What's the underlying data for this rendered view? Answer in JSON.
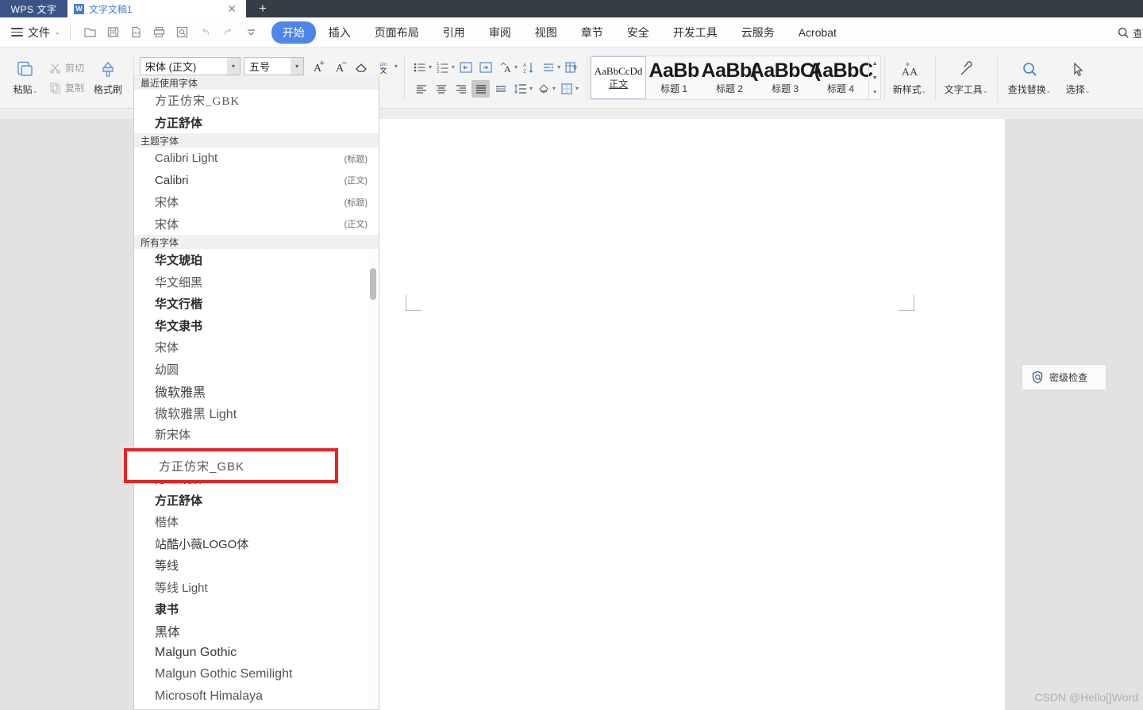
{
  "titlebar": {
    "app_badge": "WPS 文字",
    "doc_tab_icon": "W",
    "doc_tab_title": "文字文稿1",
    "close_glyph": "✕",
    "new_tab_glyph": "+"
  },
  "menubar": {
    "file_label": "文件",
    "file_caret": "⌄",
    "quick_access": [
      {
        "name": "open-icon",
        "enabled": true
      },
      {
        "name": "save-icon",
        "enabled": true
      },
      {
        "name": "export-pdf-icon",
        "enabled": true
      },
      {
        "name": "print-icon",
        "enabled": true
      },
      {
        "name": "print-preview-icon",
        "enabled": true
      },
      {
        "name": "undo-icon",
        "enabled": false
      },
      {
        "name": "redo-icon",
        "enabled": false
      },
      {
        "name": "customize-qat-icon",
        "enabled": true
      }
    ],
    "tabs": [
      {
        "label": "开始",
        "active": true
      },
      {
        "label": "插入",
        "active": false
      },
      {
        "label": "页面布局",
        "active": false
      },
      {
        "label": "引用",
        "active": false
      },
      {
        "label": "审阅",
        "active": false
      },
      {
        "label": "视图",
        "active": false
      },
      {
        "label": "章节",
        "active": false
      },
      {
        "label": "安全",
        "active": false
      },
      {
        "label": "开发工具",
        "active": false
      },
      {
        "label": "云服务",
        "active": false
      },
      {
        "label": "Acrobat",
        "active": false
      }
    ],
    "search_partial_label": "查"
  },
  "ribbon": {
    "clipboard": {
      "paste_label": "粘贴",
      "paste_caret": "⌄",
      "cut_label": "剪切",
      "copy_label": "复制",
      "format_brush_label": "格式刷"
    },
    "font": {
      "font_name_value": "宋体 (正文)",
      "font_size_value": "五号",
      "grow_font": "A",
      "shrink_font": "A",
      "clear_format": "◇",
      "pinyin": "拼"
    },
    "styles": {
      "items": [
        {
          "preview": "AaBbCcDd",
          "name": "正文",
          "selected": true
        },
        {
          "preview": "AaBb",
          "name": "标题 1",
          "selected": false
        },
        {
          "preview": "AaBb(",
          "name": "标题 2",
          "selected": false
        },
        {
          "preview": "AaBbC(",
          "name": "标题 3",
          "selected": false
        },
        {
          "preview": "AaBbC",
          "name": "标题 4",
          "selected": false
        }
      ]
    },
    "right_tools": [
      {
        "label": "新样式",
        "icon": "new-style-icon",
        "caret": "⌄"
      },
      {
        "label": "文字工具",
        "icon": "text-tools-icon",
        "caret": "⌄"
      },
      {
        "label": "查找替换",
        "icon": "find-replace-icon",
        "caret": "⌄"
      },
      {
        "label": "选择",
        "icon": "select-icon",
        "caret": "⌄"
      }
    ]
  },
  "font_dropdown": {
    "sections": [
      {
        "header": "最近使用字体",
        "items": [
          {
            "name": "方正仿宋_GBK",
            "suffix": "",
            "style": "serif tight"
          },
          {
            "name": "方正舒体",
            "suffix": "",
            "style": "bold"
          }
        ]
      },
      {
        "header": "主题字体",
        "items": [
          {
            "name": "Calibri Light",
            "suffix": "(标题)",
            "style": ""
          },
          {
            "name": "Calibri",
            "suffix": "(正文)",
            "style": "dark"
          },
          {
            "name": "宋体",
            "suffix": "(标题)",
            "style": "serif"
          },
          {
            "name": "宋体",
            "suffix": "(正文)",
            "style": "serif"
          }
        ]
      },
      {
        "header": "所有字体",
        "items": [
          {
            "name": "华文琥珀",
            "suffix": "",
            "style": "bold"
          },
          {
            "name": "华文细黑",
            "suffix": "",
            "style": ""
          },
          {
            "name": "华文行楷",
            "suffix": "",
            "style": "bold serif"
          },
          {
            "name": "华文隶书",
            "suffix": "",
            "style": "bold serif"
          },
          {
            "name": "宋体",
            "suffix": "",
            "style": "serif"
          },
          {
            "name": "幼圆",
            "suffix": "",
            "style": ""
          },
          {
            "name": "微软雅黑",
            "suffix": "",
            "style": "dark big"
          },
          {
            "name": "微软雅黑 Light",
            "suffix": "",
            "style": "big"
          },
          {
            "name": "新宋体",
            "suffix": "",
            "style": "serif"
          },
          {
            "name": "方正仿宋_GBK",
            "suffix": "",
            "style": "serif tight",
            "highlighted": true
          },
          {
            "name": "方正姚体",
            "suffix": "",
            "style": "bold tight"
          },
          {
            "name": "方正舒体",
            "suffix": "",
            "style": "bold"
          },
          {
            "name": "楷体",
            "suffix": "",
            "style": "serif"
          },
          {
            "name": "站酷小薇LOGO体",
            "suffix": "",
            "style": "dark"
          },
          {
            "name": "等线",
            "suffix": "",
            "style": "dark"
          },
          {
            "name": "等线 Light",
            "suffix": "",
            "style": ""
          },
          {
            "name": "隶书",
            "suffix": "",
            "style": "bold serif"
          },
          {
            "name": "黑体",
            "suffix": "",
            "style": "dark big"
          },
          {
            "name": "Malgun Gothic",
            "suffix": "",
            "style": "dark big"
          },
          {
            "name": "Malgun Gothic Semilight",
            "suffix": "",
            "style": "big"
          },
          {
            "name": "Microsoft Himalaya",
            "suffix": "",
            "style": "big"
          }
        ]
      }
    ]
  },
  "annotation": {
    "highlighted_font": "方正仿宋_GBK",
    "highlight_color": "#f02020"
  },
  "document": {
    "security_check_label": "密级检查",
    "security_check_icon": "shield-search-icon",
    "watermark": "CSDN @Hello[]Word"
  }
}
